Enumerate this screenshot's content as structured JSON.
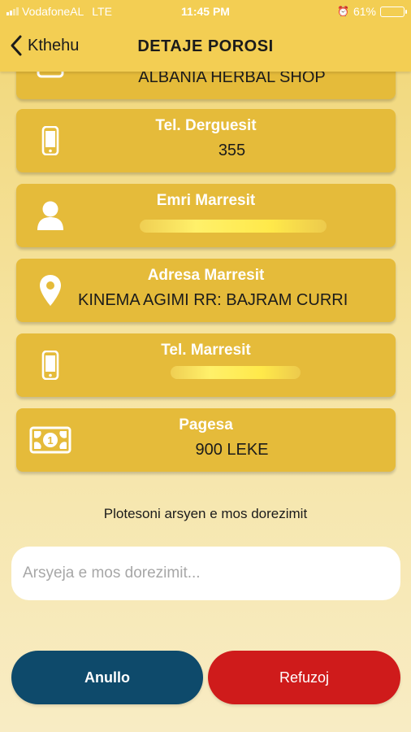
{
  "status_bar": {
    "carrier": "VodafoneAL",
    "network": "LTE",
    "time": "11:45 PM",
    "battery": "61%",
    "battery_level": 0.61
  },
  "nav": {
    "back_label": "Kthehu",
    "title": "DETAJE POROSI"
  },
  "cards": [
    {
      "icon": "store-icon",
      "label": "",
      "value": "ALBANIA HERBAL SHOP"
    },
    {
      "icon": "phone-icon",
      "label": "Tel. Derguesit",
      "value": "355"
    },
    {
      "icon": "person-icon",
      "label": "Emri Marresit",
      "value": ""
    },
    {
      "icon": "location-pin-icon",
      "label": "Adresa Marresit",
      "value": "KINEMA AGIMI RR: BAJRAM CURRI"
    },
    {
      "icon": "phone-icon",
      "label": "Tel. Marresit",
      "value": ""
    },
    {
      "icon": "money-icon",
      "label": "Pagesa",
      "value": "900 LEKE"
    }
  ],
  "reason": {
    "prompt": "Plotesoni arsyen e mos dorezimit",
    "placeholder": "Arsyeja e mos dorezimit...",
    "value": ""
  },
  "actions": {
    "cancel_label": "Anullo",
    "refuse_label": "Refuzoj"
  },
  "colors": {
    "accent": "#f3ce53",
    "card": "#e5bb3a",
    "cancel": "#0e4a6b",
    "refuse": "#cf1b1b"
  }
}
